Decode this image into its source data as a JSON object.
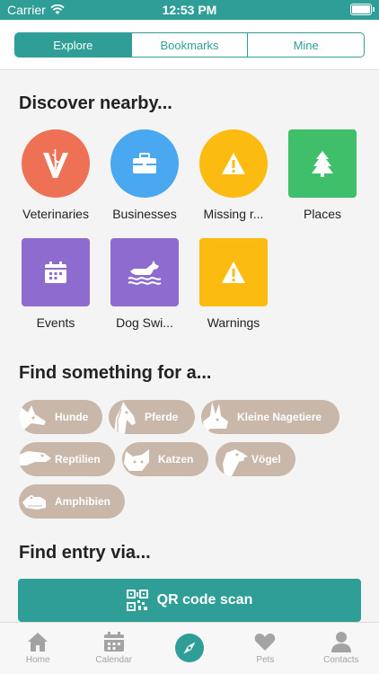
{
  "status_bar": {
    "carrier": "Carrier",
    "time": "12:53 PM"
  },
  "segments": [
    {
      "label": "Explore",
      "active": true
    },
    {
      "label": "Bookmarks",
      "active": false
    },
    {
      "label": "Mine",
      "active": false
    }
  ],
  "discover": {
    "title": "Discover nearby...",
    "items": [
      {
        "label": "Veterinaries",
        "icon": "veterinary-icon",
        "color": "#ee7155"
      },
      {
        "label": "Businesses",
        "icon": "briefcase-icon",
        "color": "#4aa8f0"
      },
      {
        "label": "Missing r...",
        "icon": "warning-icon",
        "color": "#fbbb10"
      },
      {
        "label": "Places",
        "icon": "tree-icon",
        "color": "#3fbf6a"
      },
      {
        "label": "Events",
        "icon": "calendar-icon",
        "color": "#8e6ccf"
      },
      {
        "label": "Dog Swi...",
        "icon": "dog-swimming-icon",
        "color": "#8e6ccf"
      },
      {
        "label": "Warnings",
        "icon": "warning-icon",
        "color": "#fbbb10"
      }
    ]
  },
  "find_for": {
    "title": "Find something for a...",
    "items": [
      {
        "label": "Hunde",
        "icon": "dog-icon"
      },
      {
        "label": "Pferde",
        "icon": "horse-icon"
      },
      {
        "label": "Kleine Nagetiere",
        "icon": "rabbit-icon"
      },
      {
        "label": "Reptilien",
        "icon": "reptile-icon"
      },
      {
        "label": "Katzen",
        "icon": "cat-icon"
      },
      {
        "label": "Vögel",
        "icon": "bird-icon"
      },
      {
        "label": "Amphibien",
        "icon": "frog-icon"
      }
    ]
  },
  "find_entry": {
    "title": "Find entry via...",
    "qr_label": "QR code scan"
  },
  "tabbar": [
    {
      "label": "Home",
      "icon": "home-icon"
    },
    {
      "label": "Calendar",
      "icon": "calendar-icon"
    },
    {
      "label": "",
      "icon": "compass-icon",
      "active": true
    },
    {
      "label": "Pets",
      "icon": "heart-icon"
    },
    {
      "label": "Contacts",
      "icon": "person-icon"
    }
  ]
}
